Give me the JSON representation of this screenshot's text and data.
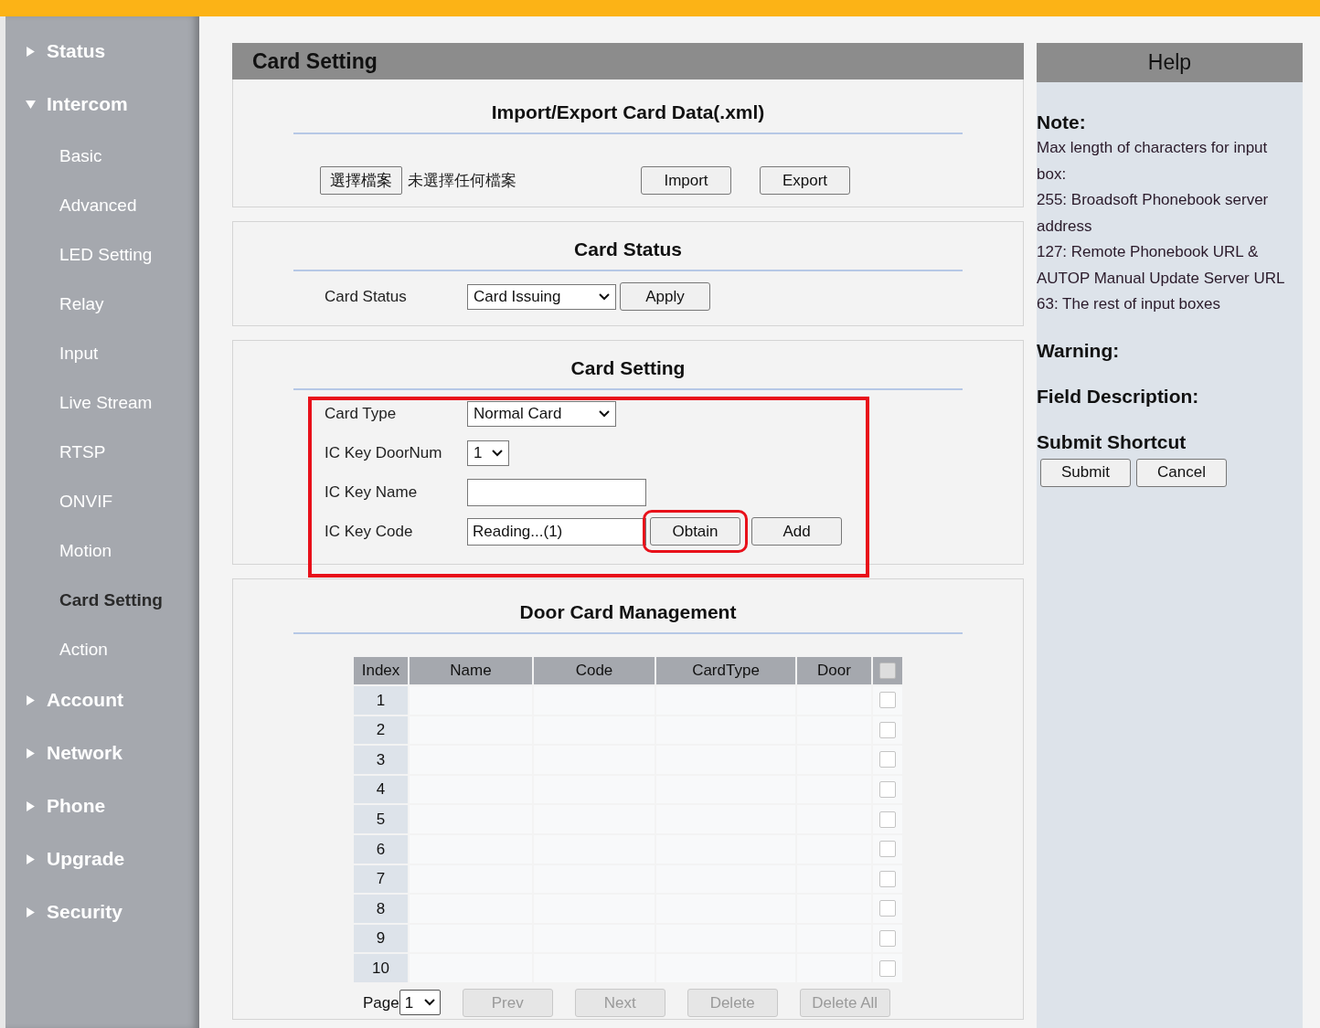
{
  "sidebar": {
    "items": [
      {
        "label": "Status",
        "expanded": false
      },
      {
        "label": "Intercom",
        "expanded": true,
        "children": [
          {
            "label": "Basic",
            "selected": false
          },
          {
            "label": "Advanced",
            "selected": false
          },
          {
            "label": "LED Setting",
            "selected": false
          },
          {
            "label": "Relay",
            "selected": false
          },
          {
            "label": "Input",
            "selected": false
          },
          {
            "label": "Live Stream",
            "selected": false
          },
          {
            "label": "RTSP",
            "selected": false
          },
          {
            "label": "ONVIF",
            "selected": false
          },
          {
            "label": "Motion",
            "selected": false
          },
          {
            "label": "Card Setting",
            "selected": true
          },
          {
            "label": "Action",
            "selected": false
          }
        ]
      },
      {
        "label": "Account",
        "expanded": false
      },
      {
        "label": "Network",
        "expanded": false
      },
      {
        "label": "Phone",
        "expanded": false
      },
      {
        "label": "Upgrade",
        "expanded": false
      },
      {
        "label": "Security",
        "expanded": false
      }
    ]
  },
  "page_title": "Card Setting",
  "sections": [
    {
      "kind": "import_export",
      "title": "Import/Export Card Data(.xml)",
      "file_button": "選擇檔案",
      "file_status": "未選擇任何檔案",
      "buttons": [
        "Import",
        "Export"
      ]
    },
    {
      "kind": "form",
      "title": "Card Status",
      "highlighted": false,
      "fields": [
        {
          "kind": "select",
          "label": "Card Status",
          "value": "Card Issuing",
          "buttons": [
            {
              "label": "Apply",
              "highlighted": false
            }
          ]
        }
      ]
    },
    {
      "kind": "form",
      "title": "Card Setting",
      "highlighted": true,
      "fields": [
        {
          "kind": "select",
          "label": "Card Type",
          "value": "Normal Card"
        },
        {
          "kind": "select",
          "label": "IC Key DoorNum",
          "value": "1"
        },
        {
          "kind": "input",
          "label": "IC Key Name"
        },
        {
          "kind": "input",
          "label": "IC Key Code",
          "value": "Reading...(1)",
          "buttons": [
            {
              "label": "Obtain",
              "highlighted": true
            },
            {
              "label": "Add",
              "highlighted": false
            }
          ]
        }
      ]
    },
    {
      "kind": "table",
      "title": "Door Card Management",
      "table": {
        "columns": [
          "Index",
          "Name",
          "Code",
          "CardType",
          "Door"
        ],
        "select_all_checked": false,
        "rows": [
          {
            "index": "1",
            "checked": false
          },
          {
            "index": "2",
            "checked": false
          },
          {
            "index": "3",
            "checked": false
          },
          {
            "index": "4",
            "checked": false
          },
          {
            "index": "5",
            "checked": false
          },
          {
            "index": "6",
            "checked": false
          },
          {
            "index": "7",
            "checked": false
          },
          {
            "index": "8",
            "checked": false
          },
          {
            "index": "9",
            "checked": false
          },
          {
            "index": "10",
            "checked": false
          }
        ]
      },
      "pagination": {
        "label": "Page",
        "page": "1",
        "buttons": [
          {
            "label": "Prev",
            "disabled": true
          },
          {
            "label": "Next",
            "disabled": true
          },
          {
            "label": "Delete",
            "disabled": true
          },
          {
            "label": "Delete All",
            "disabled": true
          }
        ]
      }
    }
  ],
  "help": {
    "title": "Help",
    "sections": [
      {
        "heading": "Note:",
        "lines": [
          "Max length of characters for input box:",
          "255: Broadsoft Phonebook server address",
          "127: Remote Phonebook URL & AUTOP Manual Update Server URL",
          "63: The rest of input boxes"
        ]
      },
      {
        "heading": "Warning:"
      },
      {
        "heading": "Field Description:"
      },
      {
        "heading": "Submit Shortcut",
        "buttons": [
          "Submit",
          "Cancel"
        ]
      }
    ]
  }
}
